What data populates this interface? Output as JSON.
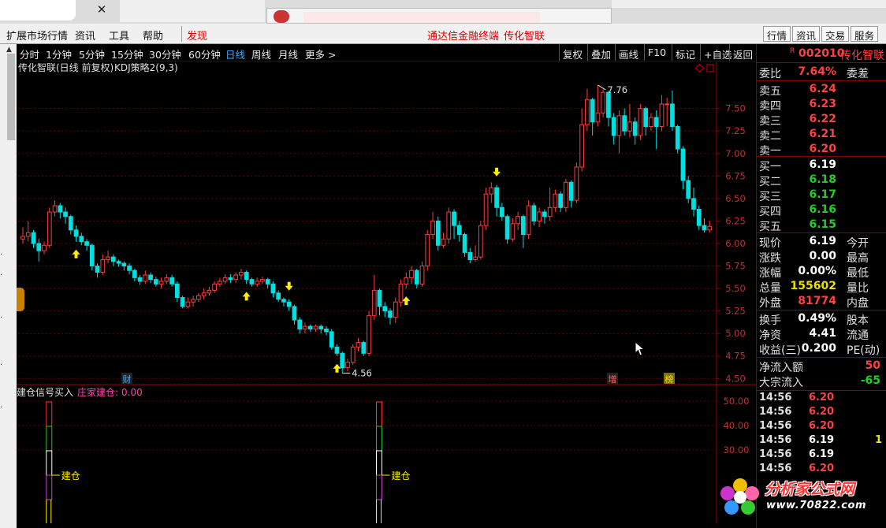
{
  "menu": {
    "items": [
      "扩展市场行情",
      "资讯",
      "工具",
      "帮助"
    ],
    "discover": "发现",
    "banner": "通达信金融终端",
    "stock_title": "传化智联",
    "right_buttons": [
      "行情",
      "资讯",
      "交易",
      "服务"
    ]
  },
  "period_bar": {
    "periods": [
      "分时",
      "1分钟",
      "5分钟",
      "15分钟",
      "30分钟",
      "60分钟",
      "日线",
      "周线",
      "月线",
      "更多 >"
    ],
    "active_period": "日线",
    "tools": [
      "复权",
      "叠加",
      "画线",
      "F10",
      "标记",
      "+自选",
      "返回"
    ]
  },
  "chart_header": {
    "title": "传化智联(日线 前复权)",
    "indicator": "KDJ策略2(9,3)",
    "high_label": "7.76",
    "low_label": "4.56",
    "markers": [
      "财",
      "增",
      "榜"
    ],
    "sub_title": "建仓信号买入",
    "sub_value_label": "庄家建仓:",
    "sub_value": "0.00",
    "signal_text": "建仓"
  },
  "quote": {
    "code": "002010",
    "name": "传化智联",
    "r_mark": "R",
    "weibi": {
      "label": "委比",
      "value": "7.64%",
      "right": "委差"
    },
    "asks": [
      {
        "label": "卖五",
        "price": "6.24"
      },
      {
        "label": "卖四",
        "price": "6.23"
      },
      {
        "label": "卖三",
        "price": "6.22"
      },
      {
        "label": "卖二",
        "price": "6.21"
      },
      {
        "label": "卖一",
        "price": "6.20"
      }
    ],
    "bids": [
      {
        "label": "买一",
        "price": "6.19"
      },
      {
        "label": "买二",
        "price": "6.18"
      },
      {
        "label": "买三",
        "price": "6.17"
      },
      {
        "label": "买四",
        "price": "6.16"
      },
      {
        "label": "买五",
        "price": "6.15"
      }
    ],
    "stats": [
      {
        "label": "现价",
        "value": "6.19",
        "right": "今开",
        "color": "#ffffff"
      },
      {
        "label": "涨跌",
        "value": "0.00",
        "right": "最高",
        "color": "#ffffff"
      },
      {
        "label": "涨幅",
        "value": "0.00%",
        "right": "最低",
        "color": "#ffffff"
      },
      {
        "label": "总量",
        "value": "155602",
        "right": "量比",
        "color": "#e8e000"
      },
      {
        "label": "外盘",
        "value": "81774",
        "right": "内盘",
        "color": "#ff4040"
      }
    ],
    "stats2": [
      {
        "label": "换手",
        "value": "0.49%",
        "right": "股本",
        "color": "#ffffff"
      },
      {
        "label": "净资",
        "value": "4.41",
        "right": "流通",
        "color": "#ffffff"
      },
      {
        "label": "收益(三)",
        "value": "0.200",
        "right": "PE(动)",
        "color": "#ffffff"
      }
    ],
    "flows": [
      {
        "label": "净流入额",
        "value": "50",
        "color": "#ff4040"
      },
      {
        "label": "大宗流入",
        "value": "-65",
        "color": "#20d020"
      }
    ],
    "ticks": [
      {
        "time": "14:56",
        "price": "6.20",
        "vol": "",
        "color": "#ff4040"
      },
      {
        "time": "14:56",
        "price": "6.20",
        "vol": "",
        "color": "#ff4040"
      },
      {
        "time": "14:56",
        "price": "6.20",
        "vol": "",
        "color": "#ff4040"
      },
      {
        "time": "14:56",
        "price": "6.19",
        "vol": "1",
        "color": "#ffffff"
      },
      {
        "time": "14:56",
        "price": "6.19",
        "vol": "",
        "color": "#ffffff"
      },
      {
        "time": "14:56",
        "price": "6.20",
        "vol": "",
        "color": "#ff4040"
      }
    ]
  },
  "watermark": {
    "title": "分析家公式网",
    "url": "www.70822.com"
  },
  "chart_data": {
    "type": "candlestick",
    "title": "传化智联(日线 前复权)",
    "price_ticks": [
      7.5,
      7.25,
      7.0,
      6.75,
      6.5,
      6.25,
      6.0,
      5.75,
      5.5,
      5.25,
      5.0,
      4.75,
      4.5
    ],
    "price_range": [
      4.45,
      7.9
    ],
    "sub_ticks": [
      50.0,
      40.0,
      30.0
    ],
    "candles": [
      [
        6.05,
        6.08,
        6.18,
        6.0
      ],
      [
        6.08,
        6.12,
        6.25,
        6.02
      ],
      [
        6.12,
        6.0,
        6.15,
        5.95
      ],
      [
        6.0,
        5.92,
        6.05,
        5.8
      ],
      [
        5.92,
        5.98,
        6.02,
        5.88
      ],
      [
        5.98,
        6.35,
        6.4,
        5.95
      ],
      [
        6.35,
        6.42,
        6.48,
        6.3
      ],
      [
        6.42,
        6.35,
        6.45,
        6.28
      ],
      [
        6.35,
        6.3,
        6.4,
        6.22
      ],
      [
        6.3,
        6.15,
        6.32,
        6.1
      ],
      [
        6.15,
        6.08,
        6.2,
        6.02
      ],
      [
        6.08,
        6.02,
        6.12,
        5.98
      ],
      [
        6.02,
        5.98,
        6.05,
        5.92
      ],
      [
        5.98,
        5.75,
        6.0,
        5.7
      ],
      [
        5.75,
        5.68,
        5.78,
        5.62
      ],
      [
        5.68,
        5.82,
        5.88,
        5.65
      ],
      [
        5.82,
        5.85,
        5.92,
        5.78
      ],
      [
        5.85,
        5.8,
        5.88,
        5.75
      ],
      [
        5.8,
        5.78,
        5.82,
        5.74
      ],
      [
        5.78,
        5.75,
        5.8,
        5.7
      ],
      [
        5.75,
        5.7,
        5.78,
        5.66
      ],
      [
        5.7,
        5.62,
        5.72,
        5.58
      ],
      [
        5.62,
        5.58,
        5.65,
        5.54
      ],
      [
        5.58,
        5.65,
        5.7,
        5.55
      ],
      [
        5.65,
        5.6,
        5.68,
        5.56
      ],
      [
        5.6,
        5.55,
        5.63,
        5.52
      ],
      [
        5.55,
        5.58,
        5.62,
        5.5
      ],
      [
        5.58,
        5.62,
        5.66,
        5.55
      ],
      [
        5.62,
        5.55,
        5.65,
        5.52
      ],
      [
        5.55,
        5.4,
        5.58,
        5.35
      ],
      [
        5.4,
        5.3,
        5.42,
        5.28
      ],
      [
        5.3,
        5.35,
        5.4,
        5.28
      ],
      [
        5.35,
        5.38,
        5.42,
        5.3
      ],
      [
        5.38,
        5.42,
        5.45,
        5.35
      ],
      [
        5.42,
        5.45,
        5.5,
        5.38
      ],
      [
        5.45,
        5.48,
        5.52,
        5.42
      ],
      [
        5.48,
        5.55,
        5.58,
        5.45
      ],
      [
        5.55,
        5.58,
        5.62,
        5.52
      ],
      [
        5.58,
        5.62,
        5.66,
        5.55
      ],
      [
        5.62,
        5.6,
        5.66,
        5.56
      ],
      [
        5.6,
        5.65,
        5.68,
        5.56
      ],
      [
        5.65,
        5.68,
        5.72,
        5.6
      ],
      [
        5.68,
        5.6,
        5.7,
        5.55
      ],
      [
        5.6,
        5.55,
        5.62,
        5.52
      ],
      [
        5.55,
        5.58,
        5.62,
        5.52
      ],
      [
        5.58,
        5.6,
        5.63,
        5.55
      ],
      [
        5.6,
        5.55,
        5.62,
        5.5
      ],
      [
        5.55,
        5.45,
        5.58,
        5.4
      ],
      [
        5.45,
        5.38,
        5.48,
        5.35
      ],
      [
        5.38,
        5.35,
        5.4,
        5.3
      ],
      [
        5.35,
        5.3,
        5.38,
        5.25
      ],
      [
        5.3,
        5.15,
        5.32,
        5.1
      ],
      [
        5.15,
        5.05,
        5.18,
        5.0
      ],
      [
        5.05,
        5.08,
        5.12,
        5.0
      ],
      [
        5.08,
        5.05,
        5.1,
        5.02
      ],
      [
        5.05,
        5.08,
        5.1,
        5.02
      ],
      [
        5.08,
        5.05,
        5.1,
        5.0
      ],
      [
        5.05,
        5.02,
        5.08,
        4.98
      ],
      [
        5.02,
        4.85,
        5.05,
        4.82
      ],
      [
        4.85,
        4.78,
        4.88,
        4.75
      ],
      [
        4.78,
        4.62,
        4.8,
        4.56
      ],
      [
        4.62,
        4.68,
        4.72,
        4.58
      ],
      [
        4.68,
        4.85,
        4.88,
        4.65
      ],
      [
        4.85,
        4.9,
        4.95,
        4.8
      ],
      [
        4.9,
        4.78,
        4.92,
        4.75
      ],
      [
        4.78,
        5.2,
        5.25,
        4.75
      ],
      [
        5.2,
        5.48,
        5.65,
        5.15
      ],
      [
        5.48,
        5.3,
        5.5,
        5.2
      ],
      [
        5.3,
        5.25,
        5.35,
        5.18
      ],
      [
        5.25,
        5.18,
        5.28,
        5.1
      ],
      [
        5.18,
        5.35,
        5.4,
        5.12
      ],
      [
        5.35,
        5.55,
        5.6,
        5.3
      ],
      [
        5.55,
        5.62,
        5.68,
        5.5
      ],
      [
        5.62,
        5.7,
        5.75,
        5.55
      ],
      [
        5.7,
        5.55,
        5.72,
        5.5
      ],
      [
        5.55,
        5.75,
        5.8,
        5.52
      ],
      [
        5.75,
        6.1,
        6.15,
        5.7
      ],
      [
        6.1,
        6.25,
        6.35,
        6.05
      ],
      [
        6.25,
        5.98,
        6.3,
        5.92
      ],
      [
        5.98,
        6.05,
        6.12,
        5.95
      ],
      [
        6.05,
        6.35,
        6.4,
        6.0
      ],
      [
        6.35,
        6.2,
        6.38,
        6.05
      ],
      [
        6.2,
        6.1,
        6.25,
        6.02
      ],
      [
        6.1,
        5.9,
        6.12,
        5.85
      ],
      [
        5.9,
        5.82,
        5.95,
        5.78
      ],
      [
        5.82,
        5.85,
        5.98,
        5.8
      ],
      [
        5.85,
        6.2,
        6.25,
        5.82
      ],
      [
        6.2,
        6.55,
        6.62,
        6.15
      ],
      [
        6.55,
        6.62,
        6.68,
        6.45
      ],
      [
        6.62,
        6.4,
        6.65,
        6.3
      ],
      [
        6.4,
        6.3,
        6.45,
        6.25
      ],
      [
        6.3,
        6.05,
        6.32,
        6.0
      ],
      [
        6.05,
        6.22,
        6.28,
        6.02
      ],
      [
        6.22,
        6.3,
        6.35,
        6.15
      ],
      [
        6.3,
        6.1,
        6.32,
        5.95
      ],
      [
        6.1,
        6.42,
        6.48,
        6.05
      ],
      [
        6.42,
        6.25,
        6.45,
        6.2
      ],
      [
        6.25,
        6.35,
        6.4,
        6.18
      ],
      [
        6.35,
        6.3,
        6.38,
        6.22
      ],
      [
        6.3,
        6.4,
        6.62,
        6.25
      ],
      [
        6.4,
        6.55,
        6.6,
        6.35
      ],
      [
        6.55,
        6.4,
        6.58,
        6.35
      ],
      [
        6.4,
        6.68,
        6.72,
        6.35
      ],
      [
        6.68,
        6.48,
        6.7,
        6.4
      ],
      [
        6.48,
        6.85,
        6.9,
        6.45
      ],
      [
        6.85,
        7.32,
        7.5,
        6.8
      ],
      [
        7.32,
        7.6,
        7.72,
        7.25
      ],
      [
        7.6,
        7.35,
        7.62,
        7.2
      ],
      [
        7.35,
        7.45,
        7.76,
        7.3
      ],
      [
        7.45,
        7.68,
        7.72,
        7.4
      ],
      [
        7.68,
        7.4,
        7.7,
        7.3
      ],
      [
        7.4,
        7.2,
        7.45,
        7.1
      ],
      [
        7.2,
        7.42,
        7.48,
        7.0
      ],
      [
        7.42,
        7.25,
        7.5,
        7.2
      ],
      [
        7.25,
        7.35,
        7.55,
        7.18
      ],
      [
        7.35,
        7.2,
        7.4,
        7.1
      ],
      [
        7.2,
        7.5,
        7.55,
        7.15
      ],
      [
        7.5,
        7.3,
        7.52,
        7.2
      ],
      [
        7.3,
        7.4,
        7.45,
        7.25
      ],
      [
        7.4,
        7.3,
        7.48,
        7.05
      ],
      [
        7.3,
        7.55,
        7.65,
        7.25
      ],
      [
        7.55,
        7.55,
        7.62,
        7.3
      ],
      [
        7.55,
        7.3,
        7.7,
        7.25
      ],
      [
        7.3,
        7.05,
        7.32,
        7.0
      ],
      [
        7.05,
        6.7,
        7.08,
        6.6
      ],
      [
        6.7,
        6.5,
        6.75,
        6.45
      ],
      [
        6.5,
        6.38,
        6.62,
        6.3
      ],
      [
        6.38,
        6.2,
        6.42,
        6.15
      ],
      [
        6.2,
        6.15,
        6.28,
        6.12
      ],
      [
        6.15,
        6.19,
        6.25,
        6.12
      ]
    ],
    "buy_arrows": [
      10,
      42,
      59,
      72
    ],
    "sell_arrows": [
      50,
      89
    ],
    "signal_bars": [
      5,
      67
    ]
  }
}
